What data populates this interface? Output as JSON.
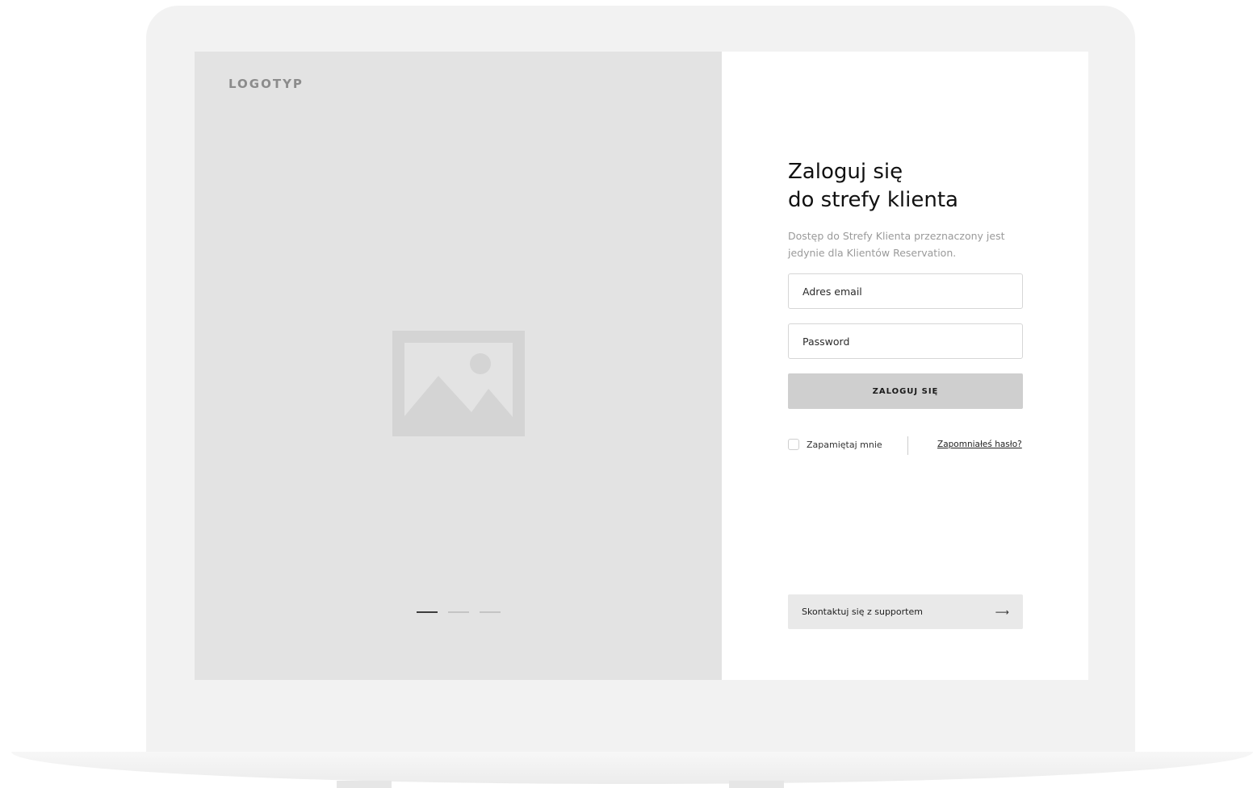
{
  "hero": {
    "logo": "LOGOTYP",
    "slides": [
      {
        "active": true
      },
      {
        "active": false
      },
      {
        "active": false
      }
    ]
  },
  "login": {
    "title_line1": "Zaloguj się",
    "title_line2": "do strefy klienta",
    "description": "Dostęp do Strefy Klienta przeznaczony jest jedynie dla Klientów Reservation.",
    "email_placeholder": "Adres email",
    "password_placeholder": "Password",
    "submit_label": "ZALOGUJ SIĘ",
    "remember_label": "Zapamiętaj mnie",
    "forgot_label": "Zapomniałeś hasło?",
    "support_label": "Skontaktuj się z supportem",
    "support_icon": "arrow-right-icon"
  },
  "colors": {
    "hero_bg": "#e3e3e3",
    "button_bg": "#cfcfcf",
    "support_bg": "#e9e9e9",
    "device_frame": "#f2f2f2"
  }
}
